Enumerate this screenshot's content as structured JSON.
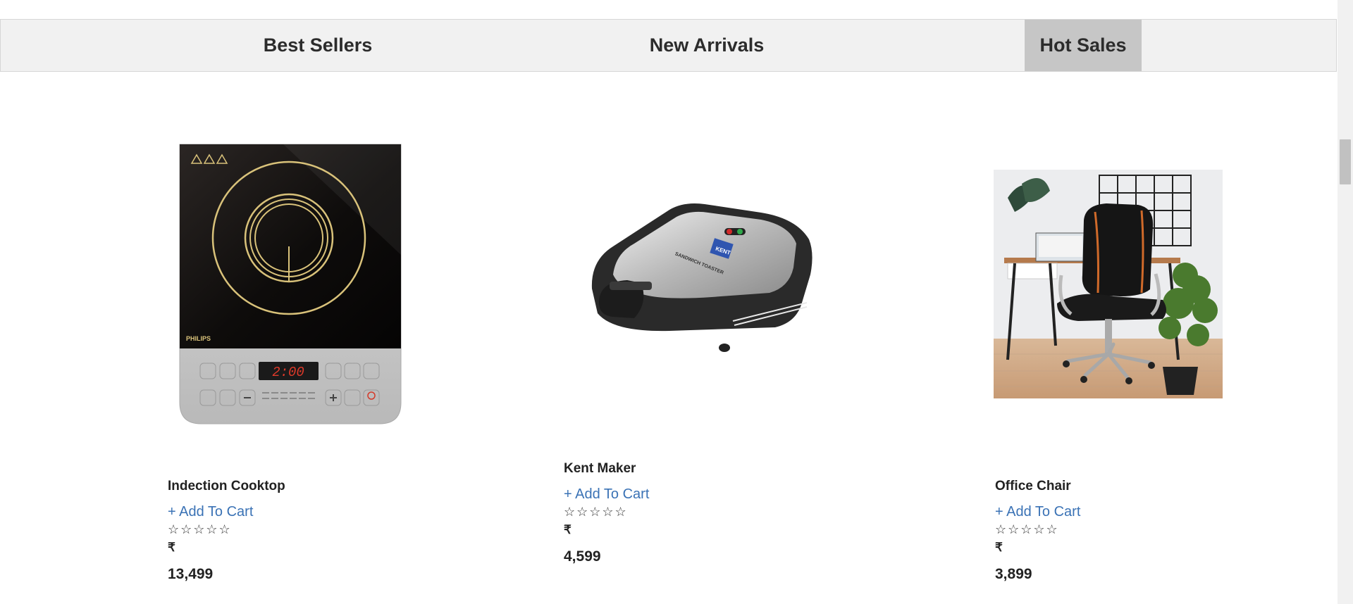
{
  "tabs": [
    {
      "label": "Best Sellers",
      "active": false
    },
    {
      "label": "New Arrivals",
      "active": false
    },
    {
      "label": "Hot Sales",
      "active": true
    }
  ],
  "products": [
    {
      "name": "Indection Cooktop",
      "add_to_cart": "+ Add To Cart",
      "rating_stars": "☆☆☆☆☆",
      "currency": "₹",
      "price": "13,499",
      "image_icon": "induction-cooktop-image",
      "brand_text": "PHILIPS",
      "display_text": "2:00"
    },
    {
      "name": "Kent Maker",
      "add_to_cart": "+ Add To Cart",
      "rating_stars": "☆☆☆☆☆",
      "currency": "₹",
      "price": "4,599",
      "image_icon": "sandwich-maker-image",
      "brand_text": "KENT",
      "model_text": "SANDWICH TOASTER"
    },
    {
      "name": "Office Chair",
      "add_to_cart": "+ Add To Cart",
      "rating_stars": "☆☆☆☆☆",
      "currency": "₹",
      "price": "3,899",
      "image_icon": "office-chair-image"
    }
  ],
  "colors": {
    "link": "#3a72b5",
    "active_tab": "#c6c6c6",
    "tabbar_bg": "#f1f1f1"
  }
}
